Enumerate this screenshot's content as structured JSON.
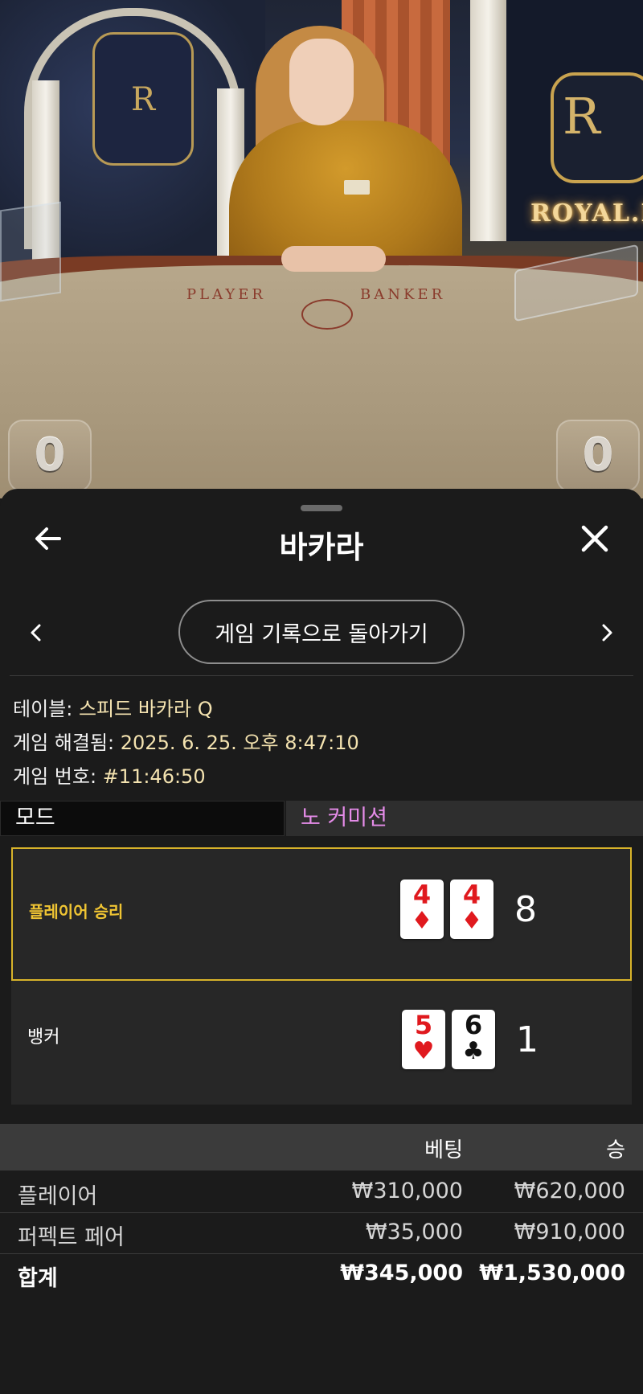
{
  "scene": {
    "felt_player": "PLAYER",
    "felt_banker": "BANKER",
    "crest_letter": "R",
    "royal_sign": "ROYAL.I",
    "player_score": "0",
    "banker_score": "0"
  },
  "header": {
    "title": "바카라"
  },
  "nav": {
    "return_label": "게임 기록으로 돌아가기"
  },
  "info": {
    "table_label": "테이블:",
    "table_value": "스피드 바카라 Q",
    "resolved_label": "게임 해결됨:",
    "resolved_value": "2025. 6. 25. 오후 8:47:10",
    "number_label": "게임 번호:",
    "number_value": "#11:46:50"
  },
  "mode": {
    "label": "모드",
    "value": "노 커미션"
  },
  "hands": {
    "player": {
      "label": "플레이어 승리",
      "cards": [
        {
          "rank": "4",
          "suit": "♦",
          "color": "#e0191e"
        },
        {
          "rank": "4",
          "suit": "♦",
          "color": "#e0191e"
        }
      ],
      "total": "8"
    },
    "banker": {
      "label": "뱅커",
      "cards": [
        {
          "rank": "5",
          "suit": "♥",
          "color": "#e0191e"
        },
        {
          "rank": "6",
          "suit": "♣",
          "color": "#111111"
        }
      ],
      "total": "1"
    }
  },
  "bets": {
    "header_bet": "베팅",
    "header_win": "승",
    "rows": [
      {
        "name": "플레이어",
        "bet": "₩310,000",
        "win": "₩620,000"
      },
      {
        "name": "퍼펙트 페어",
        "bet": "₩35,000",
        "win": "₩910,000"
      }
    ],
    "total": {
      "name": "합계",
      "bet": "₩345,000",
      "win": "₩1,530,000"
    }
  },
  "colors": {
    "accent_gold": "#d8b32a",
    "mode_value": "#e58ce9",
    "info_value": "#f4e3b0"
  }
}
